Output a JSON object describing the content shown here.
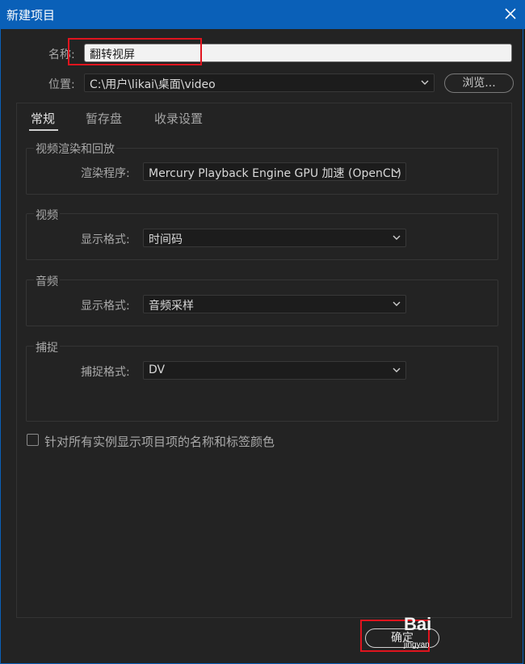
{
  "window": {
    "title": "新建项目"
  },
  "name_field": {
    "label": "名称:",
    "value": "翻转视屏"
  },
  "location": {
    "label": "位置:",
    "value": "C:\\用户\\likai\\桌面\\video",
    "browse_label": "浏览..."
  },
  "tabs": [
    {
      "label": "常规",
      "active": true
    },
    {
      "label": "暂存盘",
      "active": false
    },
    {
      "label": "收录设置",
      "active": false
    }
  ],
  "groups": {
    "render": {
      "title": "视频渲染和回放",
      "field_label": "渲染程序:",
      "value": "Mercury Playback Engine GPU 加速 (OpenCL)"
    },
    "video": {
      "title": "视频",
      "field_label": "显示格式:",
      "value": "时间码"
    },
    "audio": {
      "title": "音频",
      "field_label": "显示格式:",
      "value": "音频采样"
    },
    "capture": {
      "title": "捕捉",
      "field_label": "捕捉格式:",
      "value": "DV"
    }
  },
  "checkbox": {
    "label": "针对所有实例显示项目项的名称和标签颜色",
    "checked": false
  },
  "ok_button": {
    "label": "确定"
  },
  "watermark": {
    "text1": "Bai",
    "text2": "jingyan"
  },
  "colors": {
    "titlebar": "#0a60b8",
    "background": "#232323",
    "highlight": "#e0141e"
  },
  "icons": [
    "close-icon",
    "chevron-down-icon",
    "checkbox-icon"
  ]
}
